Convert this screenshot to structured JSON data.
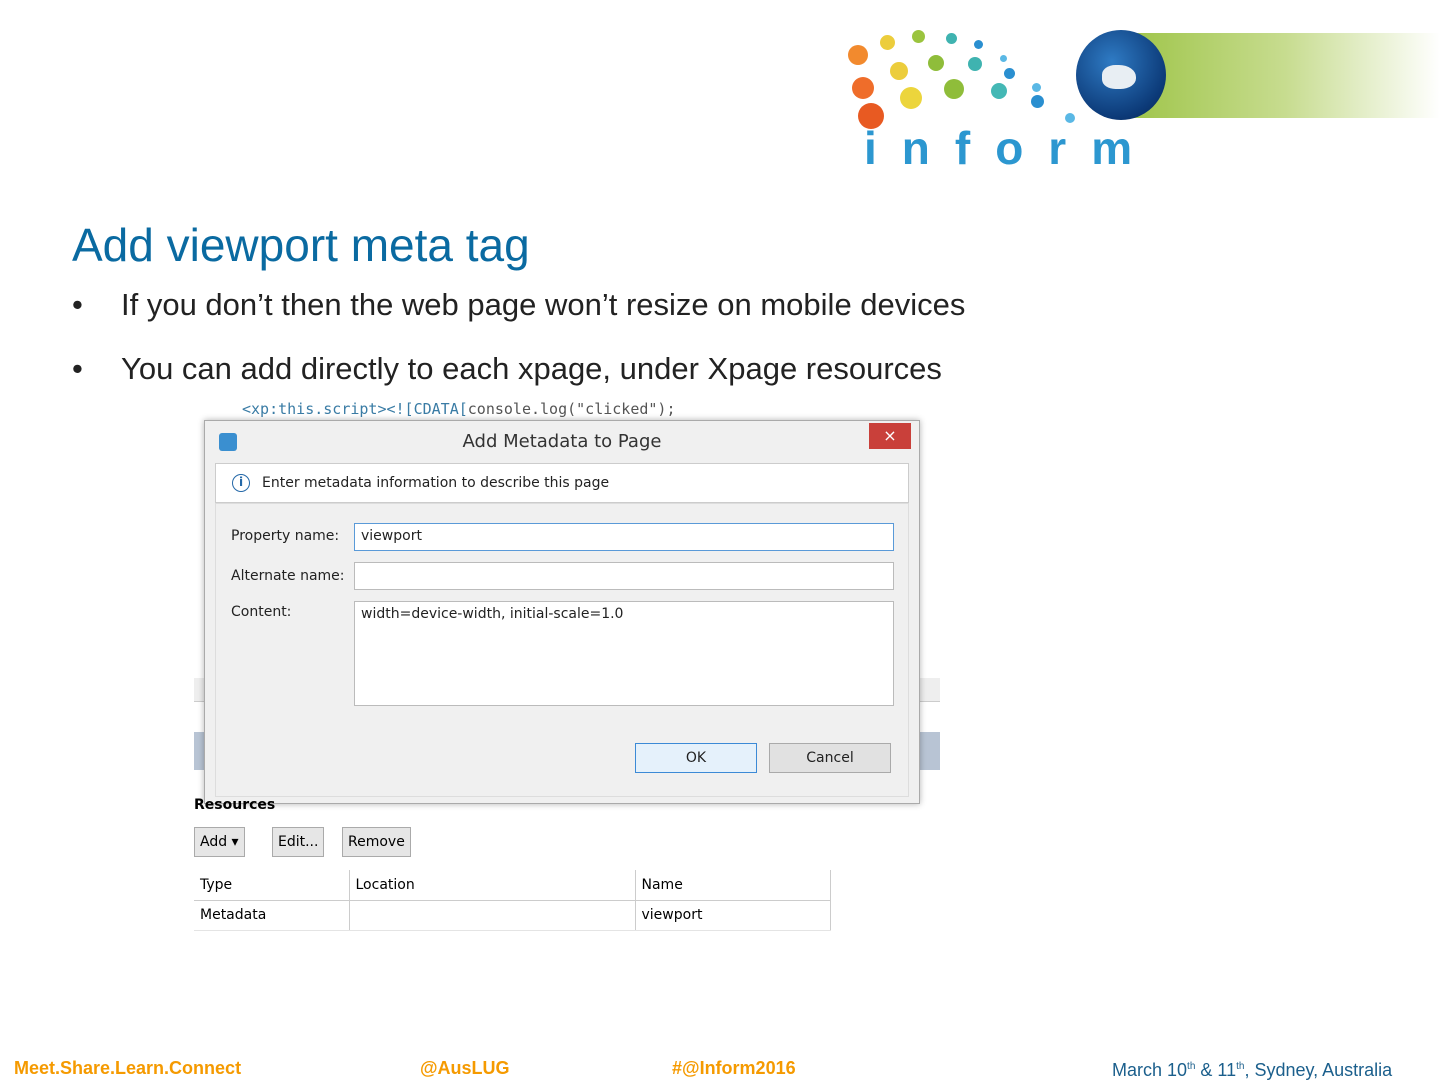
{
  "logo": {
    "text": "inform"
  },
  "slide": {
    "title": "Add viewport meta tag",
    "bullets": [
      "If you don’t then the web page won’t resize on mobile devices",
      "You can add directly to each xpage, under Xpage resources"
    ]
  },
  "screenshot": {
    "code_line": {
      "tag": "<xp:this.script><![CDATA[",
      "text": "console.log(\"clicked\");"
    },
    "dialog": {
      "title": "Add Metadata to Page",
      "close": "×",
      "info": "Enter metadata information to describe this page",
      "property_label": "Property name:",
      "property_value": "viewport",
      "alternate_label": "Alternate name:",
      "alternate_value": "",
      "content_label": "Content:",
      "content_value": "width=device-width, initial-scale=1.0",
      "ok": "OK",
      "cancel": "Cancel"
    },
    "resources": {
      "label": "Resources",
      "add": "Add ▾",
      "edit": "Edit...",
      "remove": "Remove",
      "columns": [
        "Type",
        "Location",
        "Name"
      ],
      "rows": [
        [
          "Metadata",
          "",
          "viewport"
        ]
      ]
    }
  },
  "footer": {
    "tagline": "Meet.Share.Learn.Connect",
    "twitter": "@AusLUG",
    "hashtag": "#@Inform2016",
    "date_a": "March 10",
    "sup1": "th",
    "date_b": " & 11",
    "sup2": "th",
    "date_c": ", Sydney, Australia"
  }
}
